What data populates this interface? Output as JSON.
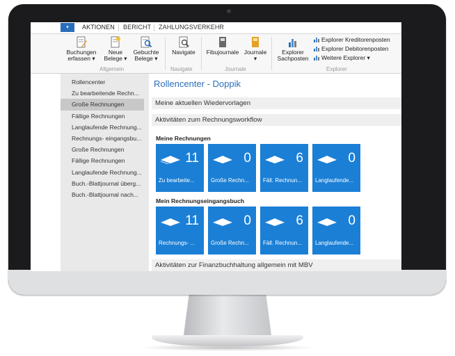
{
  "ribbon": {
    "file_glyph": "▾",
    "tabs": [
      "AKTIONEN",
      "BERICHT",
      "ZAHLUNGSVERKEHR"
    ],
    "buttons": {
      "buchungen": [
        "Buchungen",
        "erfassen ▾"
      ],
      "neue_belege": [
        "Neue",
        "Belege ▾"
      ],
      "gebuchte_belege": [
        "Gebuchte",
        "Belege ▾"
      ],
      "navigate": "Navigate",
      "fibujournale": "Fibujournale",
      "journale": [
        "Journale",
        "▾"
      ],
      "explorer_sachposten": [
        "Explorer",
        "Sachposten"
      ],
      "explorer_kreditorenposten": "Explorer Kreditorenposten",
      "explorer_debitorenposten": "Explorer Debitorenposten",
      "weitere_explorer": "Weitere Explorer ▾"
    },
    "groups": [
      "Allgemein",
      "Navigate",
      "Journale",
      "Explorer"
    ]
  },
  "nav": {
    "items": [
      "Rollencenter",
      "Zu bearbeitende Rechn...",
      "Große Rechnungen",
      "Fällige Rechnungen",
      "Langlaufende Rechnung...",
      "Rechnungs- eingangsbu...",
      "Große Rechnungen",
      "Fällige Rechnungen",
      "Langlaufende Rechnung...",
      "Buch.-Blattjournal überg...",
      "Buch.-Blattjournal nach..."
    ],
    "selected_index": 2
  },
  "main": {
    "title": "Rollencenter - Doppik",
    "sections": [
      "Meine aktuellen Wiedervorlagen",
      "Aktivitäten zum Rechnungsworkflow",
      "Aktivitäten zur Finanzbuchhaltung allgemein mit MBV"
    ],
    "groups": [
      {
        "title": "Meine Rechnungen",
        "tiles": [
          {
            "value": "11",
            "label": "Zu bearbeite..."
          },
          {
            "value": "0",
            "label": "Große Rechn..."
          },
          {
            "value": "6",
            "label": "Fäll. Rechnun..."
          },
          {
            "value": "0",
            "label": "Langlaufende..."
          }
        ]
      },
      {
        "title": "Mein Rechnungseingangsbuch",
        "tiles": [
          {
            "value": "11",
            "label": "Rechnungs- ..."
          },
          {
            "value": "0",
            "label": "Große Rechn..."
          },
          {
            "value": "6",
            "label": "Fäll. Rechnun..."
          },
          {
            "value": "0",
            "label": "Langlaufende..."
          }
        ]
      }
    ]
  },
  "colors": {
    "accent": "#2a6ebb",
    "tile": "#1b7fd6",
    "nav_bg": "#e9e9e9",
    "nav_selected": "#c8c8c8",
    "section_bg": "#efefef"
  }
}
